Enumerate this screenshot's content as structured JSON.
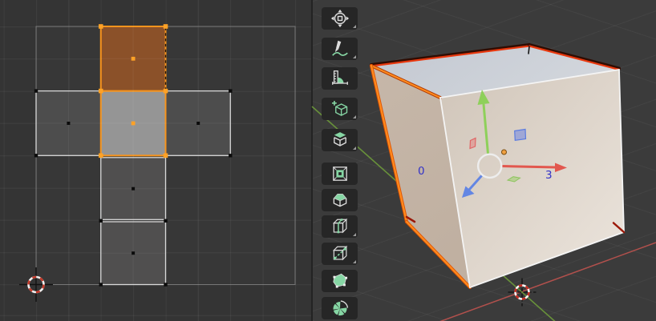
{
  "workspace": {
    "left_panel": "uv-image-editor",
    "right_panel": "3d-viewport",
    "accent_color": "#f7941d"
  },
  "uv_editor": {
    "grid_divisions": 8,
    "unwrap_layout": "cross-shaped cube unwrap",
    "faces": [
      {
        "id": "face-top",
        "state": "active",
        "fill": "#8b5129",
        "outline": "#f7941d"
      },
      {
        "id": "face-middle",
        "state": "selected",
        "fill": "#959595",
        "outline": "#f7941d"
      },
      {
        "id": "face-left",
        "state": "unselected",
        "fill": "#4d4d4d",
        "outline": "#d9d9d9"
      },
      {
        "id": "face-right",
        "state": "unselected",
        "fill": "#4d4d4d",
        "outline": "#d9d9d9"
      },
      {
        "id": "face-lower-mid",
        "state": "unselected",
        "fill": "#504f4f",
        "outline": "#d9d9d9"
      },
      {
        "id": "face-bottom",
        "state": "unselected",
        "fill": "#504f4f",
        "outline": "#d9d9d9"
      }
    ],
    "cursor_2d": {
      "position": "bottom-left corner of UV bounds",
      "colors": [
        "#f0f0f0",
        "#c43a2a"
      ]
    }
  },
  "toolbar": {
    "tools": [
      {
        "name": "Tweak",
        "icon": "tweak-select-icon",
        "flyout": true
      },
      {
        "name": "Annotate",
        "icon": "annotate-pencil-icon",
        "flyout": true
      },
      {
        "name": "Measure",
        "icon": "measure-ruler-icon",
        "flyout": false
      },
      {
        "name": "Add Cube",
        "icon": "add-cube-icon",
        "flyout": true
      },
      {
        "name": "Extrude Region",
        "icon": "extrude-region-icon",
        "flyout": true
      },
      {
        "name": "Inset Faces",
        "icon": "inset-faces-icon",
        "flyout": false
      },
      {
        "name": "Bevel",
        "icon": "bevel-icon",
        "flyout": false
      },
      {
        "name": "Loop Cut",
        "icon": "loop-cut-icon",
        "flyout": true
      },
      {
        "name": "Knife",
        "icon": "knife-icon",
        "flyout": true
      },
      {
        "name": "Poly Build",
        "icon": "poly-build-icon",
        "flyout": false
      },
      {
        "name": "Spin",
        "icon": "spin-icon",
        "flyout": false
      }
    ],
    "icon_green": "#86d6a4",
    "icon_white": "#dcdcdc"
  },
  "viewport_3d": {
    "labels": {
      "left_face": "0",
      "front_face": "3"
    },
    "label_color": "#3232c8",
    "cube": {
      "top_face_color": "#c9ced6",
      "front_face_color": "#ded4ca",
      "left_face_color": "#c3b4a6",
      "seam_edge_color": "#e8380e",
      "selected_edge_color": "#ff8d1f",
      "unselected_edge_color": "#f4f4f4"
    },
    "gizmo": {
      "arrows": [
        {
          "icon": "gizmo-arrow-green-icon",
          "color": "#8ed05a"
        },
        {
          "icon": "gizmo-arrow-red-icon",
          "color": "#e2574e"
        },
        {
          "icon": "gizmo-arrow-blue-icon",
          "color": "#6386e3"
        }
      ],
      "circle_color": "#ededed",
      "origin_dot_color": "#f0a040"
    },
    "cursor_3d": {
      "colors": [
        "#ffffff",
        "#c8281c"
      ]
    },
    "axis_lines": {
      "x_color": "#c85550",
      "y_color": "#6a963a"
    }
  }
}
